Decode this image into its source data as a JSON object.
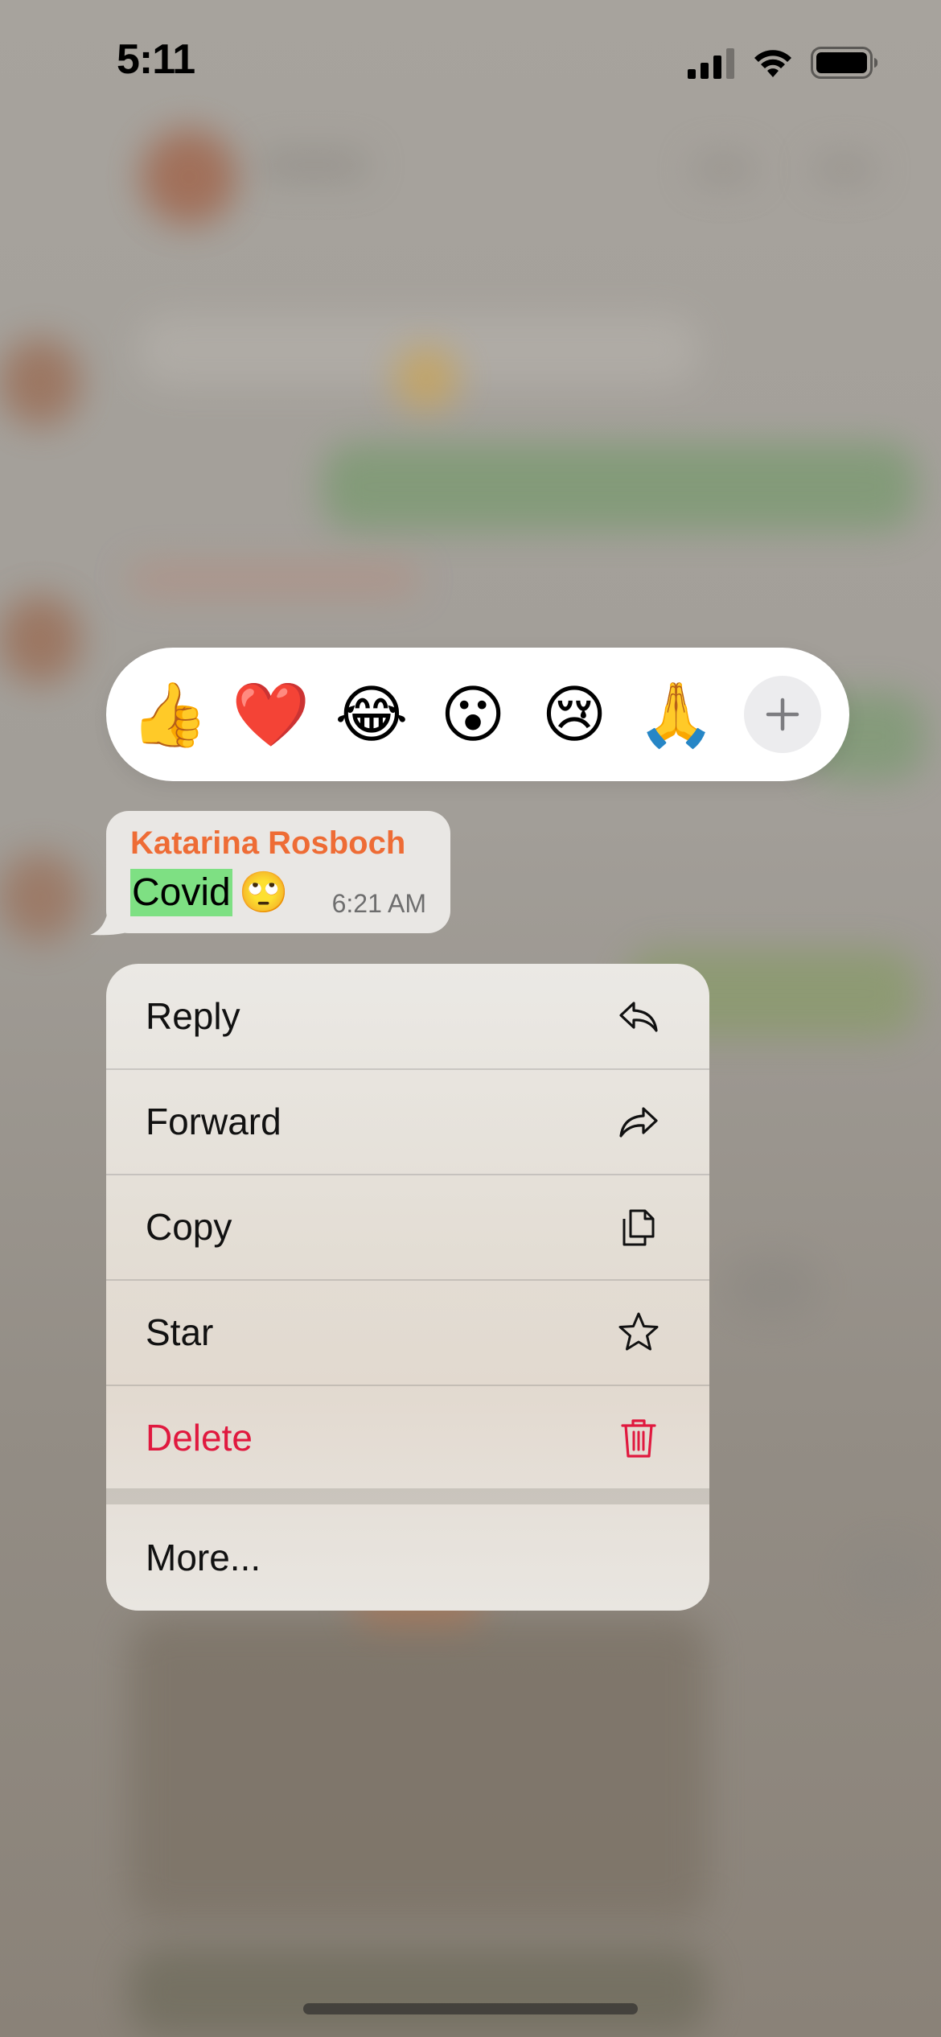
{
  "status_bar": {
    "time": "5:11"
  },
  "reactions": {
    "items": [
      "👍",
      "❤️",
      "😂",
      "😮",
      "😢",
      "🙏"
    ],
    "more_icon": "plus-icon"
  },
  "message": {
    "sender": "Katarina Rosboch",
    "highlighted_text": "Covid",
    "emoji": "🙄",
    "time": "6:21 AM"
  },
  "menu": {
    "reply": "Reply",
    "forward": "Forward",
    "copy": "Copy",
    "star": "Star",
    "delete": "Delete",
    "more": "More..."
  },
  "colors": {
    "sender": "#ee6c35",
    "delete": "#e0193f",
    "highlight": "#7ee083"
  },
  "icons": {
    "reply": "reply-arrow-icon",
    "forward": "forward-arrow-icon",
    "copy": "copy-documents-icon",
    "star": "star-icon",
    "delete": "trash-icon"
  }
}
